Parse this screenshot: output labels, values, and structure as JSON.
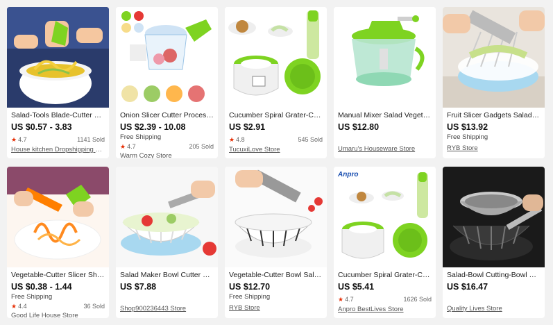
{
  "products": [
    {
      "title": "Salad-Tools Blade-Cutter Grater Sp...",
      "price": "US $0.57 - 3.83",
      "shipping": "",
      "rating": "4.7",
      "sold": "1141 Sold",
      "store": "House kitchen Dropshipping Store",
      "image": "spiral-cutter-bowl"
    },
    {
      "title": "Onion Slicer Cutter Processor Sala...",
      "price": "US $2.39 - 10.08",
      "shipping": "Free Shipping",
      "rating": "4.7",
      "sold": "205 Sold",
      "store": "Warm Cozy Store",
      "image": "food-chopper"
    },
    {
      "title": "Cucumber Spiral Grater-Cutter Sal...",
      "price": "US $2.91",
      "shipping": "",
      "rating": "4.8",
      "sold": "545 Sold",
      "store": "TucuxiLove Store",
      "image": "spiral-grater-green"
    },
    {
      "title": "Manual Mixer Salad Vegetable Cho...",
      "price": "US $12.80",
      "shipping": "",
      "rating": "",
      "sold": "",
      "store": "Umaru's Houseware Store",
      "image": "manual-mixer"
    },
    {
      "title": "Fruit Slicer Gadgets Salad Cutting-...",
      "price": "US $13.92",
      "shipping": "Free Shipping",
      "rating": "",
      "sold": "",
      "store": "RYB Store",
      "image": "salad-cutting-bowl"
    },
    {
      "title": "Vegetable-Cutter Slicer Shred-Devi...",
      "price": "US $0.38 - 1.44",
      "shipping": "Free Shipping",
      "rating": "4.4",
      "sold": "36 Sold",
      "store": "Good Life House Store",
      "image": "carrot-spiral"
    },
    {
      "title": "Salad Maker Bowl Cutter Slicer Ho...",
      "price": "US $7.88",
      "shipping": "",
      "rating": "",
      "sold": "",
      "store": "Shop900236443 Store",
      "image": "salad-bowl-blue"
    },
    {
      "title": "Vegetable-Cutter Bowl Salad Kitch...",
      "price": "US $12.70",
      "shipping": "Free Shipping",
      "rating": "",
      "sold": "",
      "store": "RYB Store",
      "image": "salad-bowl-white"
    },
    {
      "title": "Cucumber Spiral Grater-Cutter Bla...",
      "price": "US $5.41",
      "shipping": "",
      "rating": "4.7",
      "sold": "1626 Sold",
      "store": "Anpro BestLives Store",
      "image": "spiral-grater-anpro",
      "badge": "Anpro"
    },
    {
      "title": "Salad-Bowl Cutting-Bowl Fruit Stai...",
      "price": "US $16.47",
      "shipping": "",
      "rating": "",
      "sold": "",
      "store": "Quality Lives Store",
      "image": "steel-salad-bowl"
    }
  ],
  "colors": {
    "accent": "#e62e04",
    "green": "#7ed321",
    "background": "#f2f2f2"
  }
}
